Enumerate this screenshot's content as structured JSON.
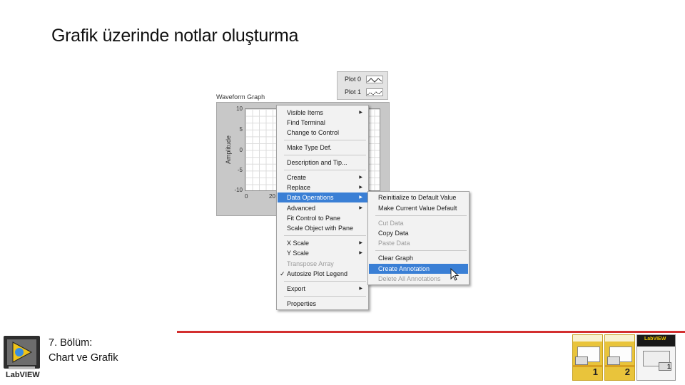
{
  "slide": {
    "title": "Grafik üzerinde notlar oluşturma",
    "chapter_line1": "7. Bölüm:",
    "chapter_line2": "Chart ve Grafik"
  },
  "legend": {
    "plots": [
      {
        "label": "Plot 0"
      },
      {
        "label": "Plot 1"
      }
    ]
  },
  "graph": {
    "label": "Waveform Graph",
    "y_title": "Amplitude",
    "y_ticks": [
      "10",
      "5",
      "0",
      "-5",
      "-10"
    ],
    "x_ticks": [
      "0",
      "20"
    ]
  },
  "context_menu": {
    "items": [
      {
        "label": "Visible Items",
        "submenu": true
      },
      {
        "label": "Find Terminal"
      },
      {
        "label": "Change to Control"
      },
      {
        "label": "Make Type Def."
      },
      {
        "label": "Description and Tip..."
      },
      {
        "label": "Create",
        "submenu": true
      },
      {
        "label": "Replace",
        "submenu": true
      },
      {
        "label": "Data Operations",
        "submenu": true,
        "selected": true
      },
      {
        "label": "Advanced",
        "submenu": true
      },
      {
        "label": "Fit Control to Pane"
      },
      {
        "label": "Scale Object with Pane"
      },
      {
        "label": "X Scale",
        "submenu": true
      },
      {
        "label": "Y Scale",
        "submenu": true
      },
      {
        "label": "Transpose Array",
        "disabled": true
      },
      {
        "label": "Autosize Plot Legend",
        "checked": true
      },
      {
        "label": "Export",
        "submenu": true
      },
      {
        "label": "Properties"
      }
    ]
  },
  "submenu": {
    "items": [
      {
        "label": "Reinitialize to Default Value"
      },
      {
        "label": "Make Current Value Default"
      },
      {
        "label": "Cut Data",
        "disabled": true
      },
      {
        "label": "Copy Data"
      },
      {
        "label": "Paste Data",
        "disabled": true
      },
      {
        "label": "Clear Graph"
      },
      {
        "label": "Create Annotation",
        "selected": true
      },
      {
        "label": "Delete All Annotations",
        "disabled": true
      }
    ]
  },
  "footer": {
    "logo_text": "LabVIEW",
    "books": [
      {
        "number": "1"
      },
      {
        "number": "2"
      },
      {
        "number": "1",
        "brand": "LabVIEW"
      }
    ]
  },
  "colors": {
    "selection": "#3a7fd5",
    "footer_rule": "#d32f2f",
    "book_yellow": "#e9c43b"
  }
}
